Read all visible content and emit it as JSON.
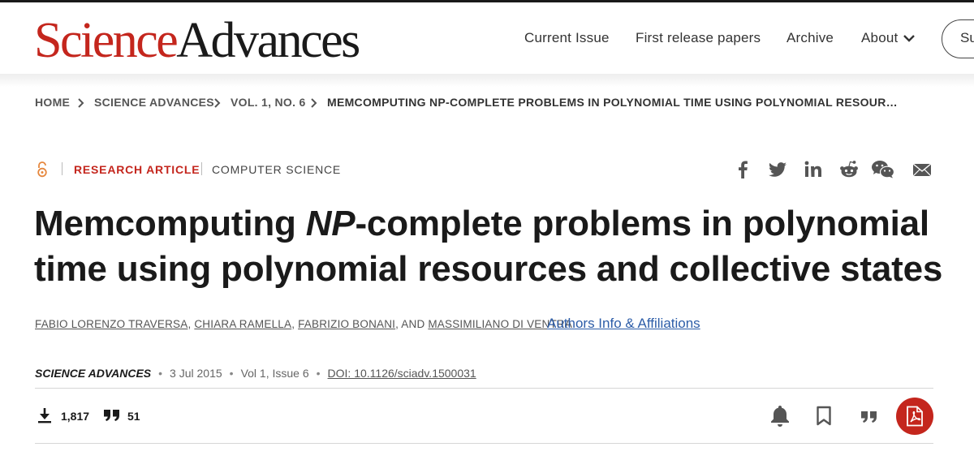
{
  "header": {
    "logo_part1": "Science",
    "logo_part2": "Advances",
    "nav": [
      {
        "label": "Current Issue"
      },
      {
        "label": "First release papers"
      },
      {
        "label": "Archive"
      },
      {
        "label": "About"
      }
    ],
    "subscribe_partial": "Su",
    "brand_red": "#c4261d"
  },
  "breadcrumb": [
    {
      "label": "HOME"
    },
    {
      "label": "SCIENCE ADVANCES"
    },
    {
      "label": "VOL. 1, NO. 6"
    },
    {
      "label": "MEMCOMPUTING NP-COMPLETE PROBLEMS IN POLYNOMIAL TIME USING POLYNOMIAL RESOURCES AND…"
    }
  ],
  "article": {
    "open_access_icon": "open-lock-icon",
    "type": "RESEARCH ARTICLE",
    "subject": "COMPUTER SCIENCE",
    "share_icons": [
      "facebook-icon",
      "twitter-icon",
      "linkedin-icon",
      "reddit-icon",
      "wechat-icon",
      "email-icon"
    ],
    "title_part1": "Memcomputing ",
    "title_italic": "NP",
    "title_part2": "-complete problems in polynomial time using polynomial resources and collective states",
    "authors": [
      "FABIO LORENZO TRAVERSA",
      "CHIARA RAMELLA",
      "FABRIZIO BONANI",
      "MASSIMILIANO DI VENTRA"
    ],
    "authors_sep1": ",",
    "authors_sep2": ",",
    "authors_sep3": ", AND",
    "affiliations_link": "Authors Info & Affiliations",
    "journal": "SCIENCE ADVANCES",
    "date": "3 Jul 2015",
    "volume_issue": "Vol 1, Issue 6",
    "doi": "DOI: 10.1126/sciadv.1500031",
    "bullet": "•"
  },
  "metrics": {
    "downloads": "1,817",
    "citations": "51"
  },
  "tools": [
    "bell-icon",
    "bookmark-icon",
    "quote-icon",
    "pdf-icon"
  ]
}
